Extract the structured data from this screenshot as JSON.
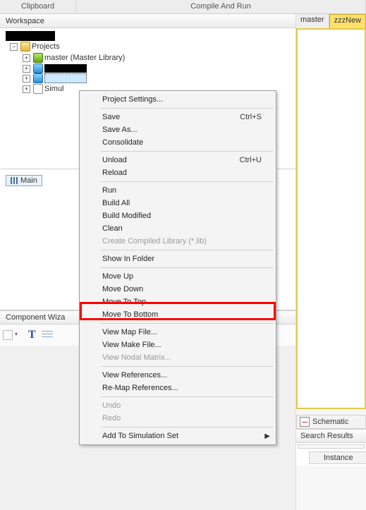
{
  "top_tabs": {
    "clipboard": "Clipboard",
    "compile_run": "Compile And Run"
  },
  "workspace": {
    "title": "Workspace",
    "controls": {
      "dropdown": "▾",
      "pin": "⫾",
      "close": "✕"
    },
    "tree": {
      "projects_label": "Projects",
      "master_label": "master (Master Library)",
      "sim_label": "Simul"
    }
  },
  "main_chip": {
    "label": "Main"
  },
  "component_wizard": {
    "title": "Component Wiza",
    "close": "✕"
  },
  "right": {
    "tab_master": "master",
    "tab_new": "zzzNew",
    "schematic": "Schematic",
    "search_title": "Search Results",
    "instance_col": "Instance"
  },
  "menu": {
    "project_settings": "Project Settings...",
    "save": "Save",
    "save_accel": "Ctrl+S",
    "save_as": "Save As...",
    "consolidate": "Consolidate",
    "unload": "Unload",
    "unload_accel": "Ctrl+U",
    "reload": "Reload",
    "run": "Run",
    "build_all": "Build All",
    "build_modified": "Build Modified",
    "clean": "Clean",
    "create_lib": "Create Compiled Library (*.lib)",
    "show_in_folder": "Show In Folder",
    "move_up": "Move Up",
    "move_down": "Move Down",
    "move_top": "Move To Top",
    "move_bottom": "Move To Bottom",
    "view_map": "View Map File...",
    "view_make": "View Make File...",
    "view_nodal": "View Nodal Matrix...",
    "view_refs": "View References...",
    "remap_refs": "Re-Map References...",
    "undo": "Undo",
    "redo": "Redo",
    "add_sim_set": "Add To Simulation Set"
  }
}
